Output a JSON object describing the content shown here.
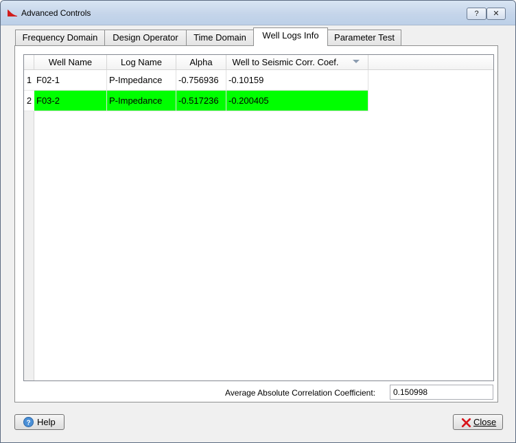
{
  "window": {
    "title": "Advanced Controls",
    "help_glyph": "?",
    "close_glyph": "✕"
  },
  "tabs": [
    {
      "label": "Frequency Domain",
      "active": false
    },
    {
      "label": "Design Operator",
      "active": false
    },
    {
      "label": "Time Domain",
      "active": false
    },
    {
      "label": "Well Logs Info",
      "active": true
    },
    {
      "label": "Parameter Test",
      "active": false
    }
  ],
  "table": {
    "columns": [
      "Well Name",
      "Log Name",
      "Alpha",
      "Well to Seismic Corr. Coef."
    ],
    "rows": [
      {
        "num": "1",
        "cells": [
          "F02-1",
          "P-Impedance",
          "-0.756936",
          "-0.10159"
        ],
        "highlighted": false
      },
      {
        "num": "2",
        "cells": [
          "F03-2",
          "P-Impedance",
          "-0.517236",
          "-0.200405"
        ],
        "highlighted": true
      }
    ],
    "highlight_color": "#00ff00"
  },
  "summary": {
    "label": "Average Absolute Correlation Coefficient:",
    "value": "0.150998"
  },
  "buttons": {
    "help_label": "Help",
    "close_label": "Close"
  },
  "icons": {
    "app": "red-wavelet-icon",
    "help": "help-circle-icon",
    "close": "red-x-icon",
    "sort": "sort-descending-icon"
  }
}
